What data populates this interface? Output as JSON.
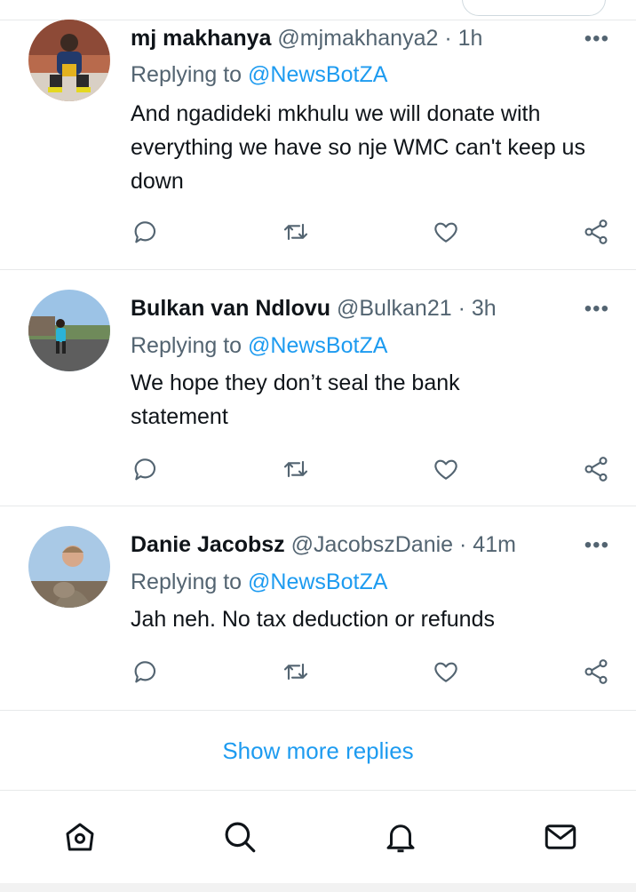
{
  "tweets": [
    {
      "name": "mj makhanya",
      "handle": "@mjmakhanya2",
      "separator": "·",
      "time": "1h",
      "replying_label": "Replying to",
      "replying_to": "@NewsBotZA",
      "text": "And ngadideki mkhulu we will donate with everything we have so nje WMC can't keep us down"
    },
    {
      "name": "Bulkan van Ndlovu",
      "handle": "@Bulkan21",
      "separator": "·",
      "time": "3h",
      "replying_label": "Replying to",
      "replying_to": "@NewsBotZA",
      "text": "We hope they don’t seal the bank statement"
    },
    {
      "name": "Danie Jacobsz",
      "handle": "@JacobszDanie",
      "separator": "·",
      "time": "41m",
      "replying_label": "Replying to",
      "replying_to": "@NewsBotZA",
      "text": "Jah neh. No tax deduction or refunds"
    }
  ],
  "more_label": "•••",
  "action_icons": [
    "reply-icon",
    "retweet-icon",
    "like-icon",
    "share-icon"
  ],
  "show_more": "Show more replies",
  "bottom_nav": [
    "home-icon",
    "search-icon",
    "notifications-icon",
    "messages-icon"
  ],
  "colors": {
    "accent": "#1d9bf0",
    "text": "#0f1419",
    "secondary": "#536471",
    "divider": "#e7e9ea"
  }
}
